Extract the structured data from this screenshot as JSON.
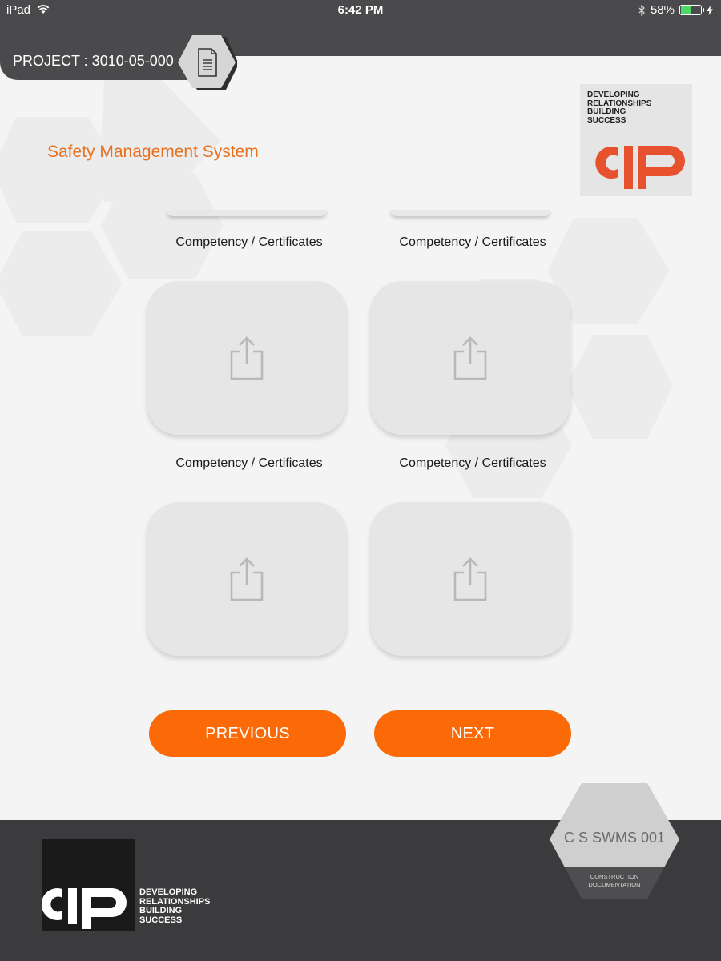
{
  "status_bar": {
    "device": "iPad",
    "time": "6:42 PM",
    "battery": "58%",
    "battery_level": 0.58
  },
  "header": {
    "project_label": "PROJECT : 3010-05-000"
  },
  "page": {
    "title": "Safety Management System"
  },
  "brand": {
    "tagline": "DEVELOPING\nRELATIONSHIPS\nBUILDING\nSUCCESS",
    "logo_text": "CIP"
  },
  "tiles": [
    {
      "caption": "Competency / Certificates",
      "icon": "share-upload-icon"
    },
    {
      "caption": "Competency / Certificates",
      "icon": "share-upload-icon"
    },
    {
      "caption": "Competency / Certificates",
      "icon": "share-upload-icon"
    },
    {
      "caption": "Competency / Certificates",
      "icon": "share-upload-icon"
    }
  ],
  "nav": {
    "previous_label": "PREVIOUS",
    "next_label": "NEXT"
  },
  "footer": {
    "doc_code": "C S SWMS 001",
    "doc_category": "CONSTRUCTION\nDOCUMENTATION"
  },
  "colors": {
    "accent": "#fb6a06",
    "title": "#e8711f",
    "dark": "#4a4a4c",
    "logo_red": "#e8512d"
  }
}
